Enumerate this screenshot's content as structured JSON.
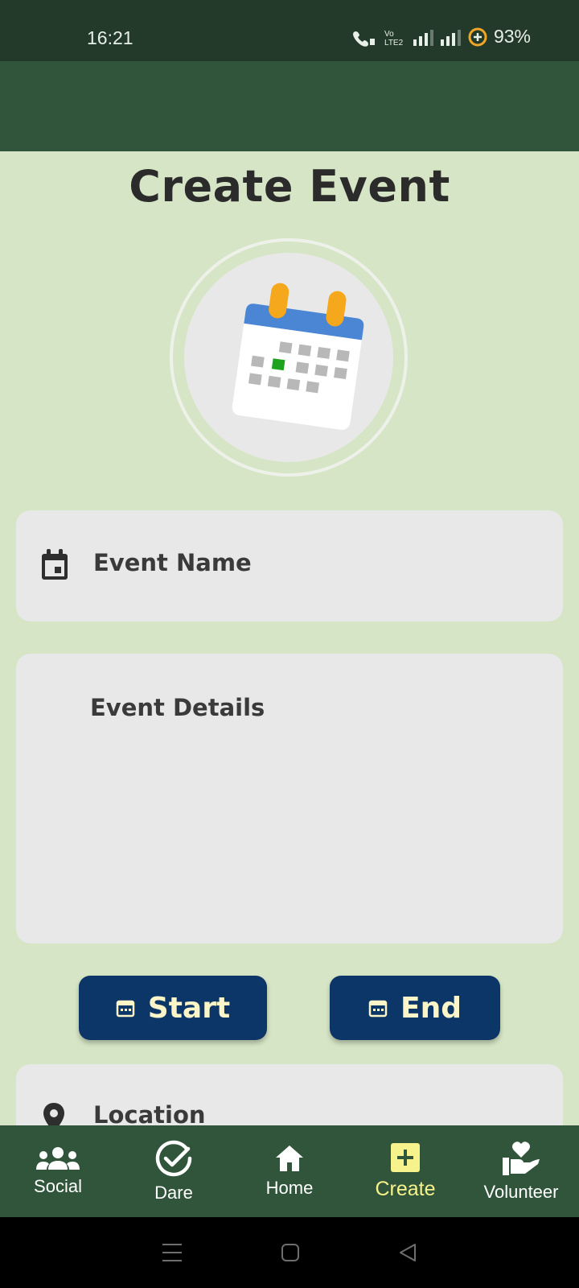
{
  "status_bar": {
    "time": "16:21",
    "battery": "93%"
  },
  "page": {
    "title": "Create Event"
  },
  "form": {
    "event_name_placeholder": "Event Name",
    "event_details_placeholder": "Event Details",
    "location_placeholder": "Location"
  },
  "buttons": {
    "start": "Start",
    "end": "End"
  },
  "bottom_nav": {
    "items": [
      {
        "label": "Social",
        "icon": "group-icon"
      },
      {
        "label": "Dare",
        "icon": "check-circle-icon"
      },
      {
        "label": "Home",
        "icon": "home-icon"
      },
      {
        "label": "Create",
        "icon": "add-box-icon",
        "active": true
      },
      {
        "label": "Volunteer",
        "icon": "volunteer-hand-heart-icon"
      }
    ]
  },
  "colors": {
    "status_bar": "#233a2a",
    "app_bar": "#30553a",
    "background": "#d6e5c5",
    "field": "#e8e8e8",
    "button": "#0c3568",
    "button_text": "#fbf5c8",
    "nav_active": "#f6f28c"
  }
}
